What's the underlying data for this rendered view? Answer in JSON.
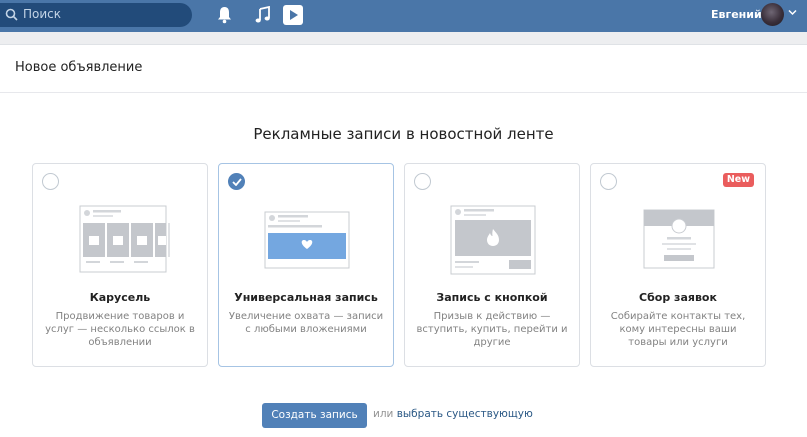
{
  "header": {
    "search_placeholder": "Поиск",
    "user_name": "Евгений",
    "icons": [
      "search-icon",
      "bell-icon",
      "music-icon",
      "video-icon",
      "chevron-down-icon"
    ],
    "bar_color": "#4a76a8"
  },
  "page": {
    "title": "Новое объявление",
    "section_title": "Рекламные записи в новостной ленте"
  },
  "cards": [
    {
      "name": "Карусель",
      "desc": "Продвижение товаров и услуг — несколько ссылок в объявлении",
      "selected": false
    },
    {
      "name": "Универсальная запись",
      "desc": "Увеличение охвата — записи с любыми вложениями",
      "selected": true
    },
    {
      "name": "Запись с кнопкой",
      "desc": "Призыв к действию — вступить, купить, перейти и другие",
      "selected": false
    },
    {
      "name": "Сбор заявок",
      "desc": "Собирайте контакты тех, кому интересны ваши товары или услуги",
      "selected": false,
      "badge": "New"
    }
  ],
  "actions": {
    "create_label": "Создать запись",
    "or_label": "или",
    "choose_existing_label": "выбрать существующую"
  },
  "colors": {
    "accent": "#5181b8",
    "badge": "#ea5d5d"
  }
}
